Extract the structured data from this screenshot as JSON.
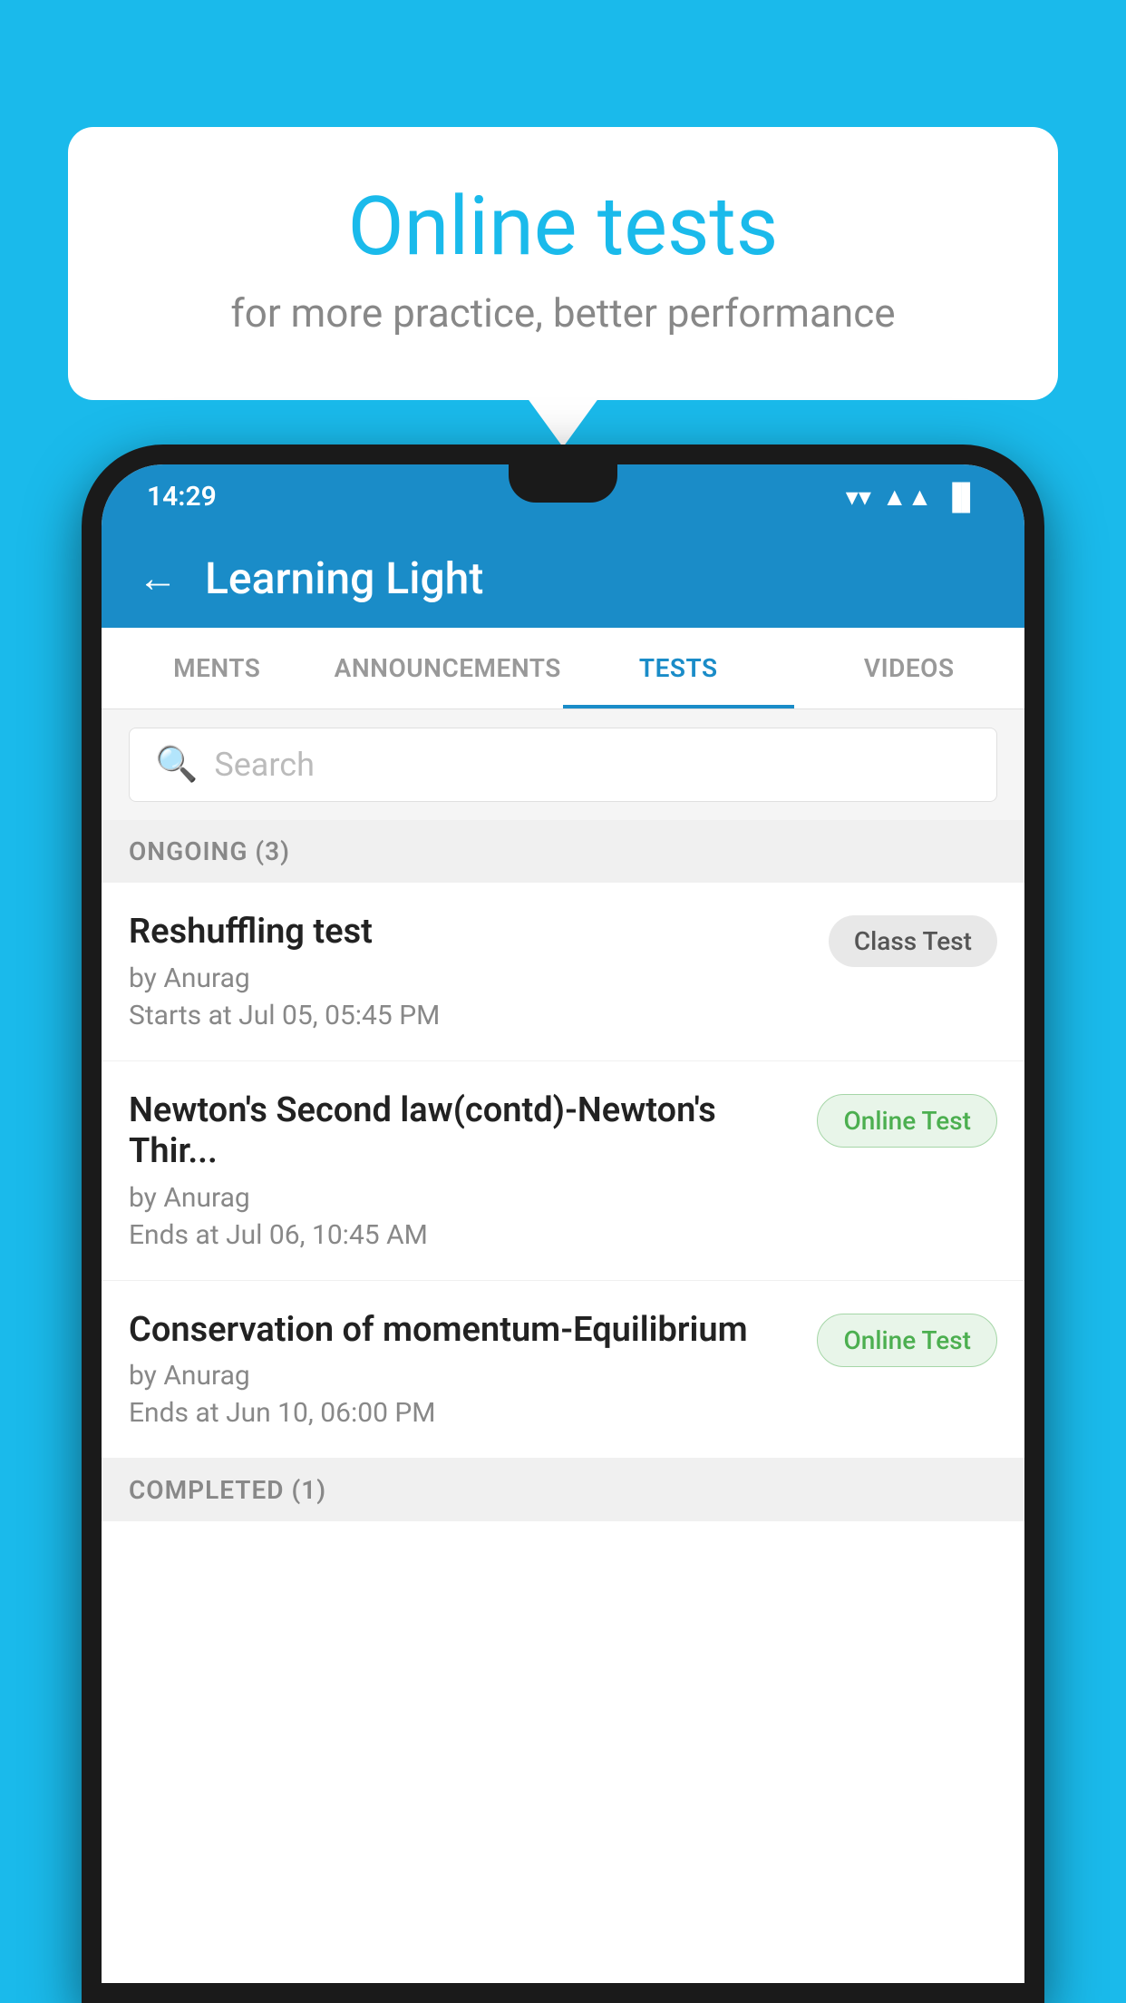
{
  "background_color": "#1ABAEB",
  "speech_bubble": {
    "title": "Online tests",
    "subtitle": "for more practice, better performance"
  },
  "status_bar": {
    "time": "14:29",
    "wifi": "▼",
    "signal": "▲",
    "battery": "▐"
  },
  "app_header": {
    "title": "Learning Light",
    "back_label": "←"
  },
  "tabs": [
    {
      "label": "MENTS",
      "active": false
    },
    {
      "label": "ANNOUNCEMENTS",
      "active": false
    },
    {
      "label": "TESTS",
      "active": true
    },
    {
      "label": "VIDEOS",
      "active": false
    }
  ],
  "search": {
    "placeholder": "Search"
  },
  "ongoing_section": {
    "label": "ONGOING (3)"
  },
  "tests": [
    {
      "name": "Reshuffling test",
      "author": "by Anurag",
      "time_label": "Starts at",
      "time": "Jul 05, 05:45 PM",
      "badge": "Class Test",
      "badge_type": "class"
    },
    {
      "name": "Newton's Second law(contd)-Newton's Thir...",
      "author": "by Anurag",
      "time_label": "Ends at",
      "time": "Jul 06, 10:45 AM",
      "badge": "Online Test",
      "badge_type": "online"
    },
    {
      "name": "Conservation of momentum-Equilibrium",
      "author": "by Anurag",
      "time_label": "Ends at",
      "time": "Jun 10, 06:00 PM",
      "badge": "Online Test",
      "badge_type": "online"
    }
  ],
  "completed_section": {
    "label": "COMPLETED (1)"
  }
}
